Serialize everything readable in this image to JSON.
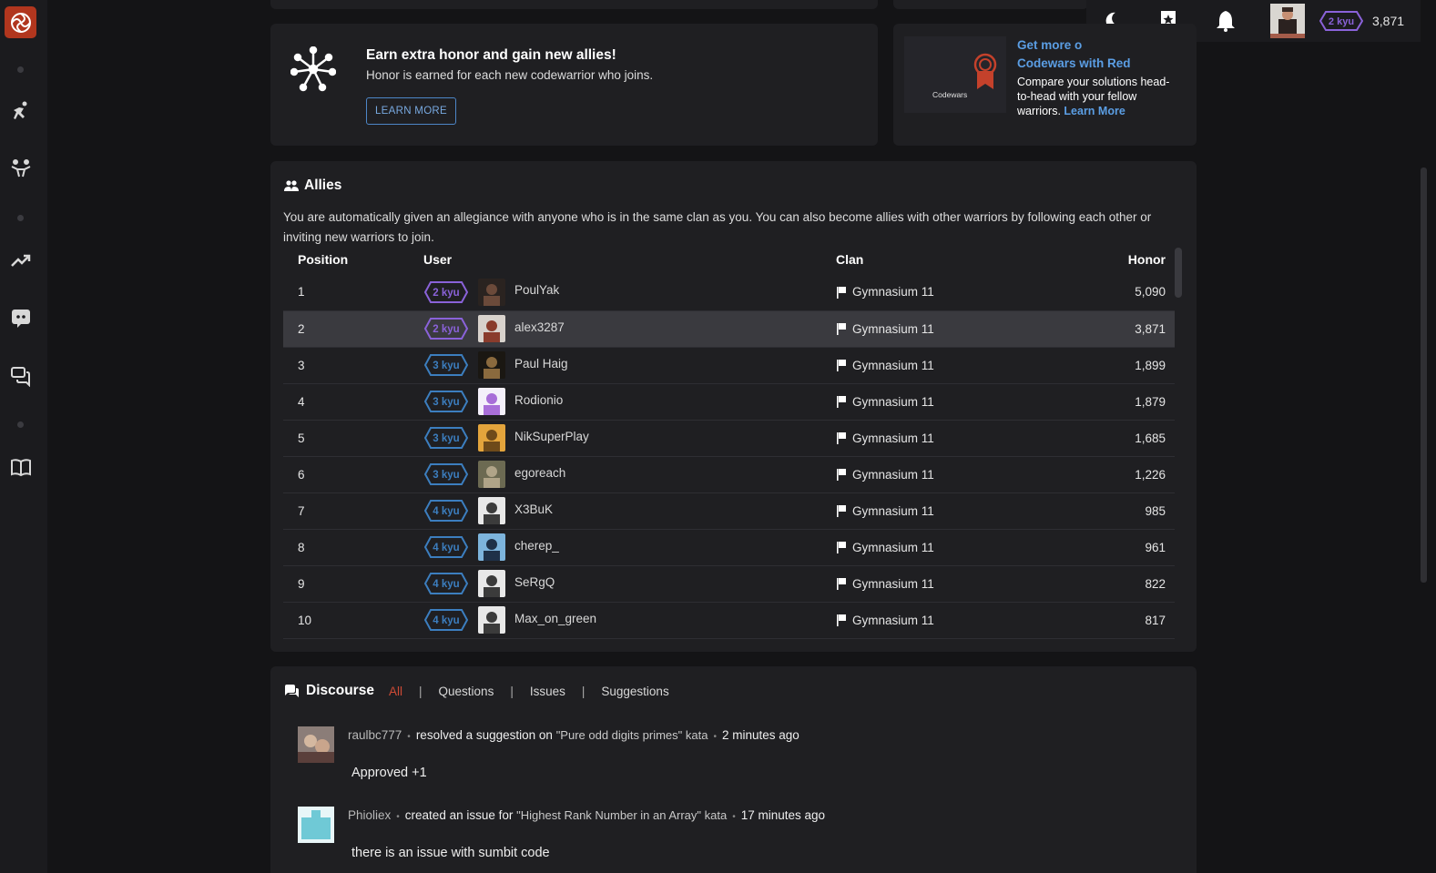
{
  "topbar": {
    "honor": "3,871",
    "rank": "2 kyu",
    "icons": [
      "moon-icon",
      "bookmark-star-icon",
      "bell-icon"
    ]
  },
  "sidebar": {
    "icons": [
      "codewars-logo",
      "training-icon",
      "practice-icon",
      "leaderboards-icon",
      "discord-icon",
      "discussion-icon",
      "docs-icon"
    ]
  },
  "honor_promo": {
    "title": "Earn extra honor and gain new allies!",
    "subtitle": "Honor is earned for each new codewarrior who joins.",
    "button": "LEARN MORE"
  },
  "red_promo": {
    "logo_text": "Codewars",
    "title": "Get more o\nCodewars with Red",
    "desc": "Compare your solutions head-to-head with your fellow warriors.",
    "link": "Learn More"
  },
  "allies": {
    "title": "Allies",
    "description": "You are automatically given an allegiance with anyone who is in the same clan as you. You can also become allies with other warriors by following each other or inviting new warriors to join.",
    "columns": {
      "position": "Position",
      "user": "User",
      "clan": "Clan",
      "honor": "Honor"
    },
    "rows": [
      {
        "position": "1",
        "rank": "2 kyu",
        "user": "PoulYak",
        "clan": "Gymnasium 11",
        "honor": "5,090"
      },
      {
        "position": "2",
        "rank": "2 kyu",
        "user": "alex3287",
        "clan": "Gymnasium 11",
        "honor": "3,871"
      },
      {
        "position": "3",
        "rank": "3 kyu",
        "user": "Paul Haig",
        "clan": "Gymnasium 11",
        "honor": "1,899"
      },
      {
        "position": "4",
        "rank": "3 kyu",
        "user": "Rodionio",
        "clan": "Gymnasium 11",
        "honor": "1,879"
      },
      {
        "position": "5",
        "rank": "3 kyu",
        "user": "NikSuperPlay",
        "clan": "Gymnasium 11",
        "honor": "1,685"
      },
      {
        "position": "6",
        "rank": "3 kyu",
        "user": "egoreach",
        "clan": "Gymnasium 11",
        "honor": "1,226"
      },
      {
        "position": "7",
        "rank": "4 kyu",
        "user": "X3BuK",
        "clan": "Gymnasium 11",
        "honor": "985"
      },
      {
        "position": "8",
        "rank": "4 kyu",
        "user": "cherep_",
        "clan": "Gymnasium 11",
        "honor": "961"
      },
      {
        "position": "9",
        "rank": "4 kyu",
        "user": "SeRgQ",
        "clan": "Gymnasium 11",
        "honor": "822"
      },
      {
        "position": "10",
        "rank": "4 kyu",
        "user": "Max_on_green",
        "clan": "Gymnasium 11",
        "honor": "817"
      }
    ]
  },
  "discourse": {
    "title": "Discourse",
    "tabs": [
      "All",
      "Questions",
      "Issues",
      "Suggestions"
    ],
    "posts": [
      {
        "user": "raulbc777",
        "action": "resolved a suggestion on",
        "kata": "\"Pure odd digits primes\" kata",
        "time": "2 minutes ago",
        "body": "Approved +1"
      },
      {
        "user": "Phioliex",
        "action": "created an issue for",
        "kata": "\"Highest Rank Number in an Array\" kata",
        "time": "17 minutes ago",
        "body": "there is an issue with sumbit code"
      }
    ]
  },
  "colors": {
    "purple_rank": "#8a62d9",
    "blue_rank": "#3c7ebf",
    "accent_red": "#b1361e",
    "link_blue": "#5b9ee4"
  }
}
